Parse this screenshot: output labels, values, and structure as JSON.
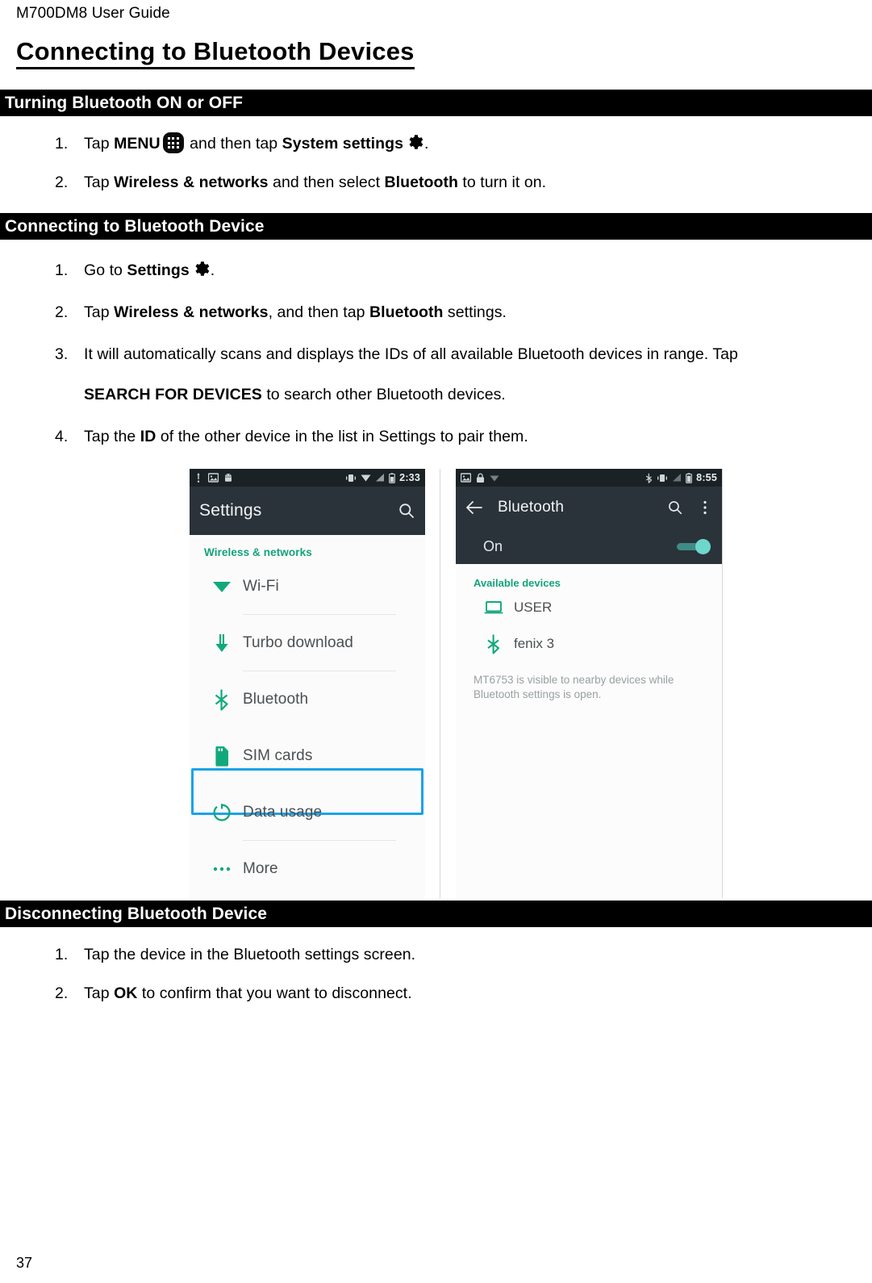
{
  "document": {
    "running_header": "M700DM8 User Guide",
    "title": "Connecting to Bluetooth Devices",
    "page_number": "37"
  },
  "sections": [
    {
      "heading": "Turning Bluetooth ON or OFF",
      "steps": [
        {
          "num": "1.",
          "pre": "Tap ",
          "bold1": "MENU",
          "icon1": "menu-grid-icon",
          "mid": " and then tap ",
          "bold2": "System settings",
          "icon2": "gear-icon",
          "post": "."
        },
        {
          "num": "2.",
          "pre": "Tap ",
          "bold1": "Wireless & networks",
          "mid": " and then select ",
          "bold2": "Bluetooth",
          "post": " to turn it on."
        }
      ]
    },
    {
      "heading": "Connecting to Bluetooth Device",
      "steps": [
        {
          "num": "1.",
          "pre": "Go to ",
          "bold1": "Settings",
          "icon2": "gear-icon",
          "post": "."
        },
        {
          "num": "2.",
          "pre": "Tap ",
          "bold1": "Wireless & networks",
          "mid": ", and then tap ",
          "bold2": "Bluetooth",
          "post": " settings."
        },
        {
          "num": "3.",
          "pre": "It will automatically scans and displays the IDs of all available Bluetooth devices in range. Tap",
          "cont_bold": "SEARCH FOR DEVICES",
          "cont_post": " to search other Bluetooth devices."
        },
        {
          "num": "4.",
          "pre": "Tap the ",
          "bold1": "ID",
          "post": " of the other device in the list in Settings to pair them."
        }
      ]
    },
    {
      "heading": "Disconnecting Bluetooth Device",
      "steps": [
        {
          "num": "1.",
          "pre": "Tap the device in the Bluetooth settings screen."
        },
        {
          "num": "2.",
          "pre": "Tap ",
          "bold1": "OK",
          "post": " to confirm that you want to disconnect."
        }
      ]
    }
  ],
  "screenshots": {
    "settings": {
      "statusbar": {
        "left_icons": [
          "usb-icon",
          "image-icon",
          "android-icon"
        ],
        "right_icons": [
          "vibrate-icon",
          "wifi-icon",
          "signal-icon",
          "battery-icon"
        ],
        "time": "2:33"
      },
      "appbar": {
        "title": "Settings",
        "search_icon": "search-icon"
      },
      "group_label": "Wireless & networks",
      "rows": [
        {
          "label": "Wi-Fi",
          "icon": "wifi-icon",
          "highlighted": false
        },
        {
          "label": "Turbo download",
          "icon": "download-arrow-icon",
          "highlighted": false
        },
        {
          "label": "Bluetooth",
          "icon": "bluetooth-icon",
          "highlighted": true
        },
        {
          "label": "SIM cards",
          "icon": "sim-card-icon",
          "highlighted": false
        },
        {
          "label": "Data usage",
          "icon": "data-usage-icon",
          "highlighted": false
        },
        {
          "label": "More",
          "icon": "more-dots-icon",
          "highlighted": false
        }
      ],
      "accent_color": "#12a37a",
      "highlight_color": "#1aa3e8"
    },
    "bluetooth": {
      "statusbar": {
        "left_icons": [
          "image-icon",
          "lock-icon",
          "wifi-icon"
        ],
        "right_icons": [
          "bluetooth-icon",
          "vibrate-icon",
          "signal-icon",
          "battery-icon"
        ],
        "time": "8:55"
      },
      "appbar": {
        "back_icon": "back-arrow-icon",
        "title": "Bluetooth",
        "search_icon": "search-icon",
        "overflow_icon": "overflow-menu-icon"
      },
      "toggle_row": {
        "label": "On",
        "state": "on"
      },
      "section_label": "Available devices",
      "devices": [
        {
          "name": "USER",
          "icon": "laptop-icon"
        },
        {
          "name": "fenix 3",
          "icon": "bluetooth-icon"
        }
      ],
      "note": "MT6753 is visible to nearby devices while Bluetooth settings is open."
    }
  }
}
